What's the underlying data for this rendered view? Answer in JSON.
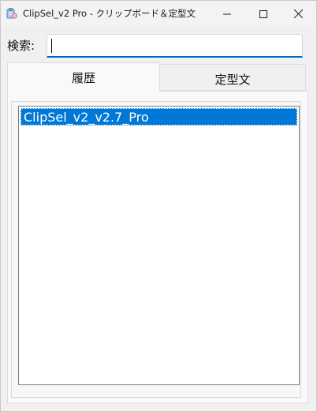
{
  "window": {
    "title": "ClipSel_v2 Pro - クリップボード＆定型文",
    "controls": {
      "minimize": "minimize-icon",
      "maximize": "maximize-icon",
      "close": "close-icon"
    }
  },
  "search": {
    "label": "検索:",
    "value": "",
    "placeholder": ""
  },
  "tabs": [
    {
      "label": "履歴",
      "active": true
    },
    {
      "label": "定型文",
      "active": false
    }
  ],
  "history": {
    "items": [
      {
        "text": "ClipSel_v2_v2.7_Pro",
        "selected": true
      }
    ]
  },
  "colors": {
    "accent": "#0078d7",
    "input_focus": "#0067c0",
    "background": "#f0f0f0"
  }
}
